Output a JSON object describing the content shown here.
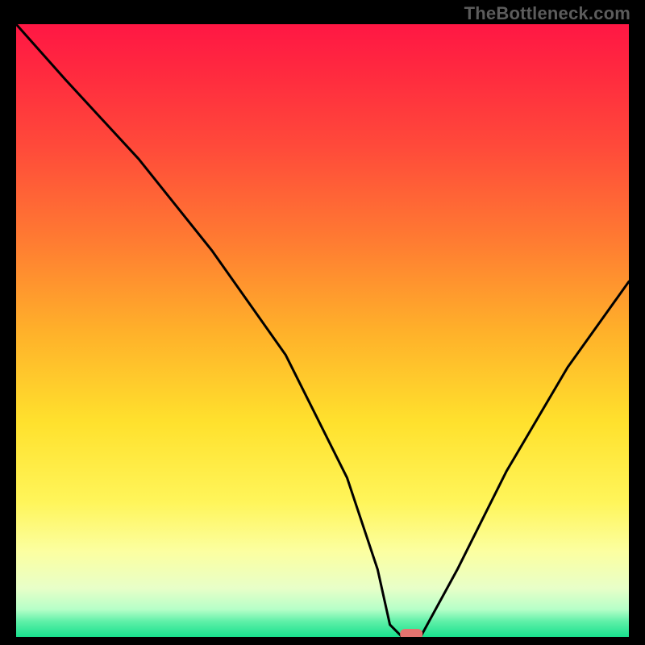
{
  "watermark": "TheBottleneck.com",
  "chart_data": {
    "type": "line",
    "title": "",
    "xlabel": "",
    "ylabel": "",
    "xlim": [
      0,
      100
    ],
    "ylim": [
      0,
      100
    ],
    "grid": false,
    "legend": false,
    "x": [
      0,
      8,
      20,
      32,
      44,
      54,
      59,
      61,
      63,
      66,
      72,
      80,
      90,
      100
    ],
    "values": [
      100,
      91,
      78,
      63,
      46,
      26,
      11,
      2,
      0,
      0,
      11,
      27,
      44,
      58
    ],
    "marker": {
      "x": 64.5,
      "y": 0
    },
    "gradient_stops": [
      {
        "offset": 0.0,
        "color": "#ff1744"
      },
      {
        "offset": 0.08,
        "color": "#ff2a3f"
      },
      {
        "offset": 0.2,
        "color": "#ff4a3a"
      },
      {
        "offset": 0.35,
        "color": "#ff7a32"
      },
      {
        "offset": 0.5,
        "color": "#ffb02a"
      },
      {
        "offset": 0.65,
        "color": "#ffe12d"
      },
      {
        "offset": 0.78,
        "color": "#fff55a"
      },
      {
        "offset": 0.86,
        "color": "#fcffa0"
      },
      {
        "offset": 0.92,
        "color": "#e8ffc8"
      },
      {
        "offset": 0.955,
        "color": "#b6ffc8"
      },
      {
        "offset": 0.975,
        "color": "#5ef0a8"
      },
      {
        "offset": 1.0,
        "color": "#18e08e"
      }
    ]
  }
}
